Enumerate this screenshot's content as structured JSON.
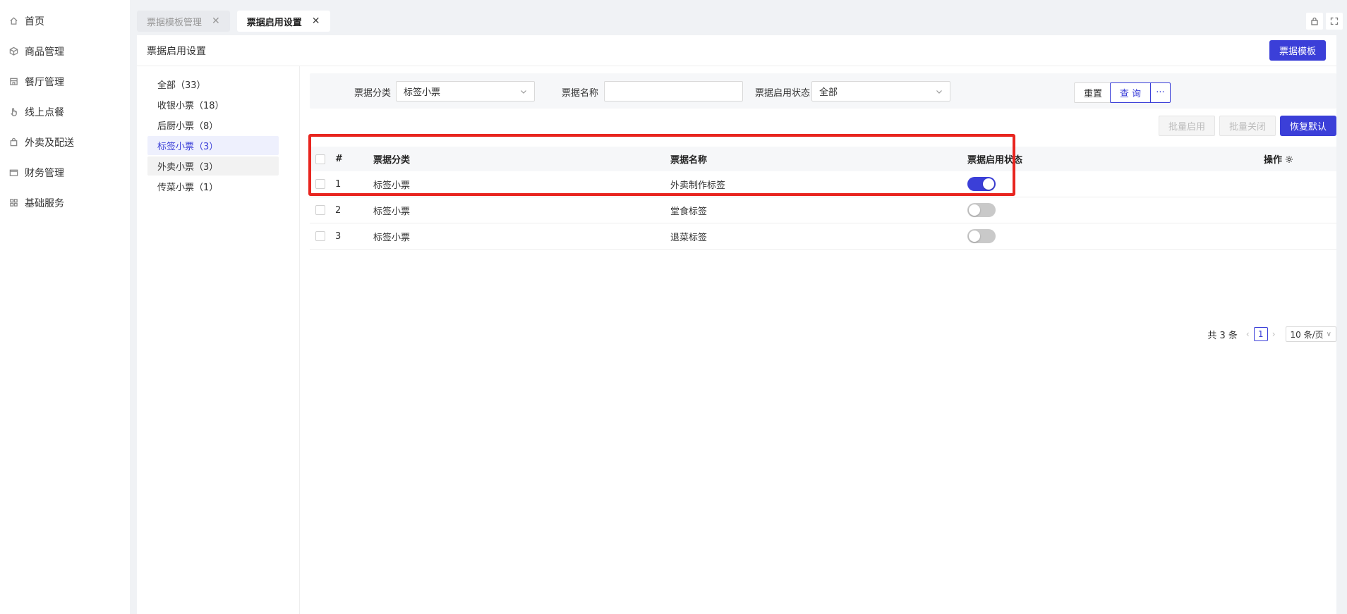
{
  "sidebar": {
    "items": [
      {
        "label": "首页",
        "icon": "home-icon"
      },
      {
        "label": "商品管理",
        "icon": "box-icon"
      },
      {
        "label": "餐厅管理",
        "icon": "store-icon"
      },
      {
        "label": "线上点餐",
        "icon": "hand-icon"
      },
      {
        "label": "外卖及配送",
        "icon": "bag-icon"
      },
      {
        "label": "财务管理",
        "icon": "wallet-icon"
      },
      {
        "label": "基础服务",
        "icon": "grid-icon"
      }
    ]
  },
  "tabs": [
    {
      "label": "票据模板管理",
      "active": false
    },
    {
      "label": "票据启用设置",
      "active": true
    }
  ],
  "page": {
    "title": "票据启用设置",
    "template_button": "票据模板"
  },
  "categories": [
    {
      "label": "全部（33）"
    },
    {
      "label": "收银小票（18）"
    },
    {
      "label": "后厨小票（8）"
    },
    {
      "label": "标签小票（3）"
    },
    {
      "label": "外卖小票（3）"
    },
    {
      "label": "传菜小票（1）"
    }
  ],
  "filter": {
    "category_label": "票据分类",
    "category_value": "标签小票",
    "name_label": "票据名称",
    "name_value": "",
    "status_label": "票据启用状态",
    "status_value": "全部",
    "reset_label": "重置",
    "query_label": "查 询",
    "more_label": "···"
  },
  "actions": {
    "batch_enable": "批量启用",
    "batch_disable": "批量关闭",
    "restore_default": "恢复默认"
  },
  "table": {
    "headers": {
      "index": "#",
      "category": "票据分类",
      "name": "票据名称",
      "status": "票据启用状态",
      "operation": "操作"
    },
    "rows": [
      {
        "index": "1",
        "category": "标签小票",
        "name": "外卖制作标签",
        "enabled": true
      },
      {
        "index": "2",
        "category": "标签小票",
        "name": "堂食标签",
        "enabled": false
      },
      {
        "index": "3",
        "category": "标签小票",
        "name": "退菜标签",
        "enabled": false
      }
    ]
  },
  "pagination": {
    "total": "共 3 条",
    "current": "1",
    "page_size": "10 条/页"
  },
  "colors": {
    "primary": "#3b3fd8",
    "highlight": "#e8251f"
  }
}
